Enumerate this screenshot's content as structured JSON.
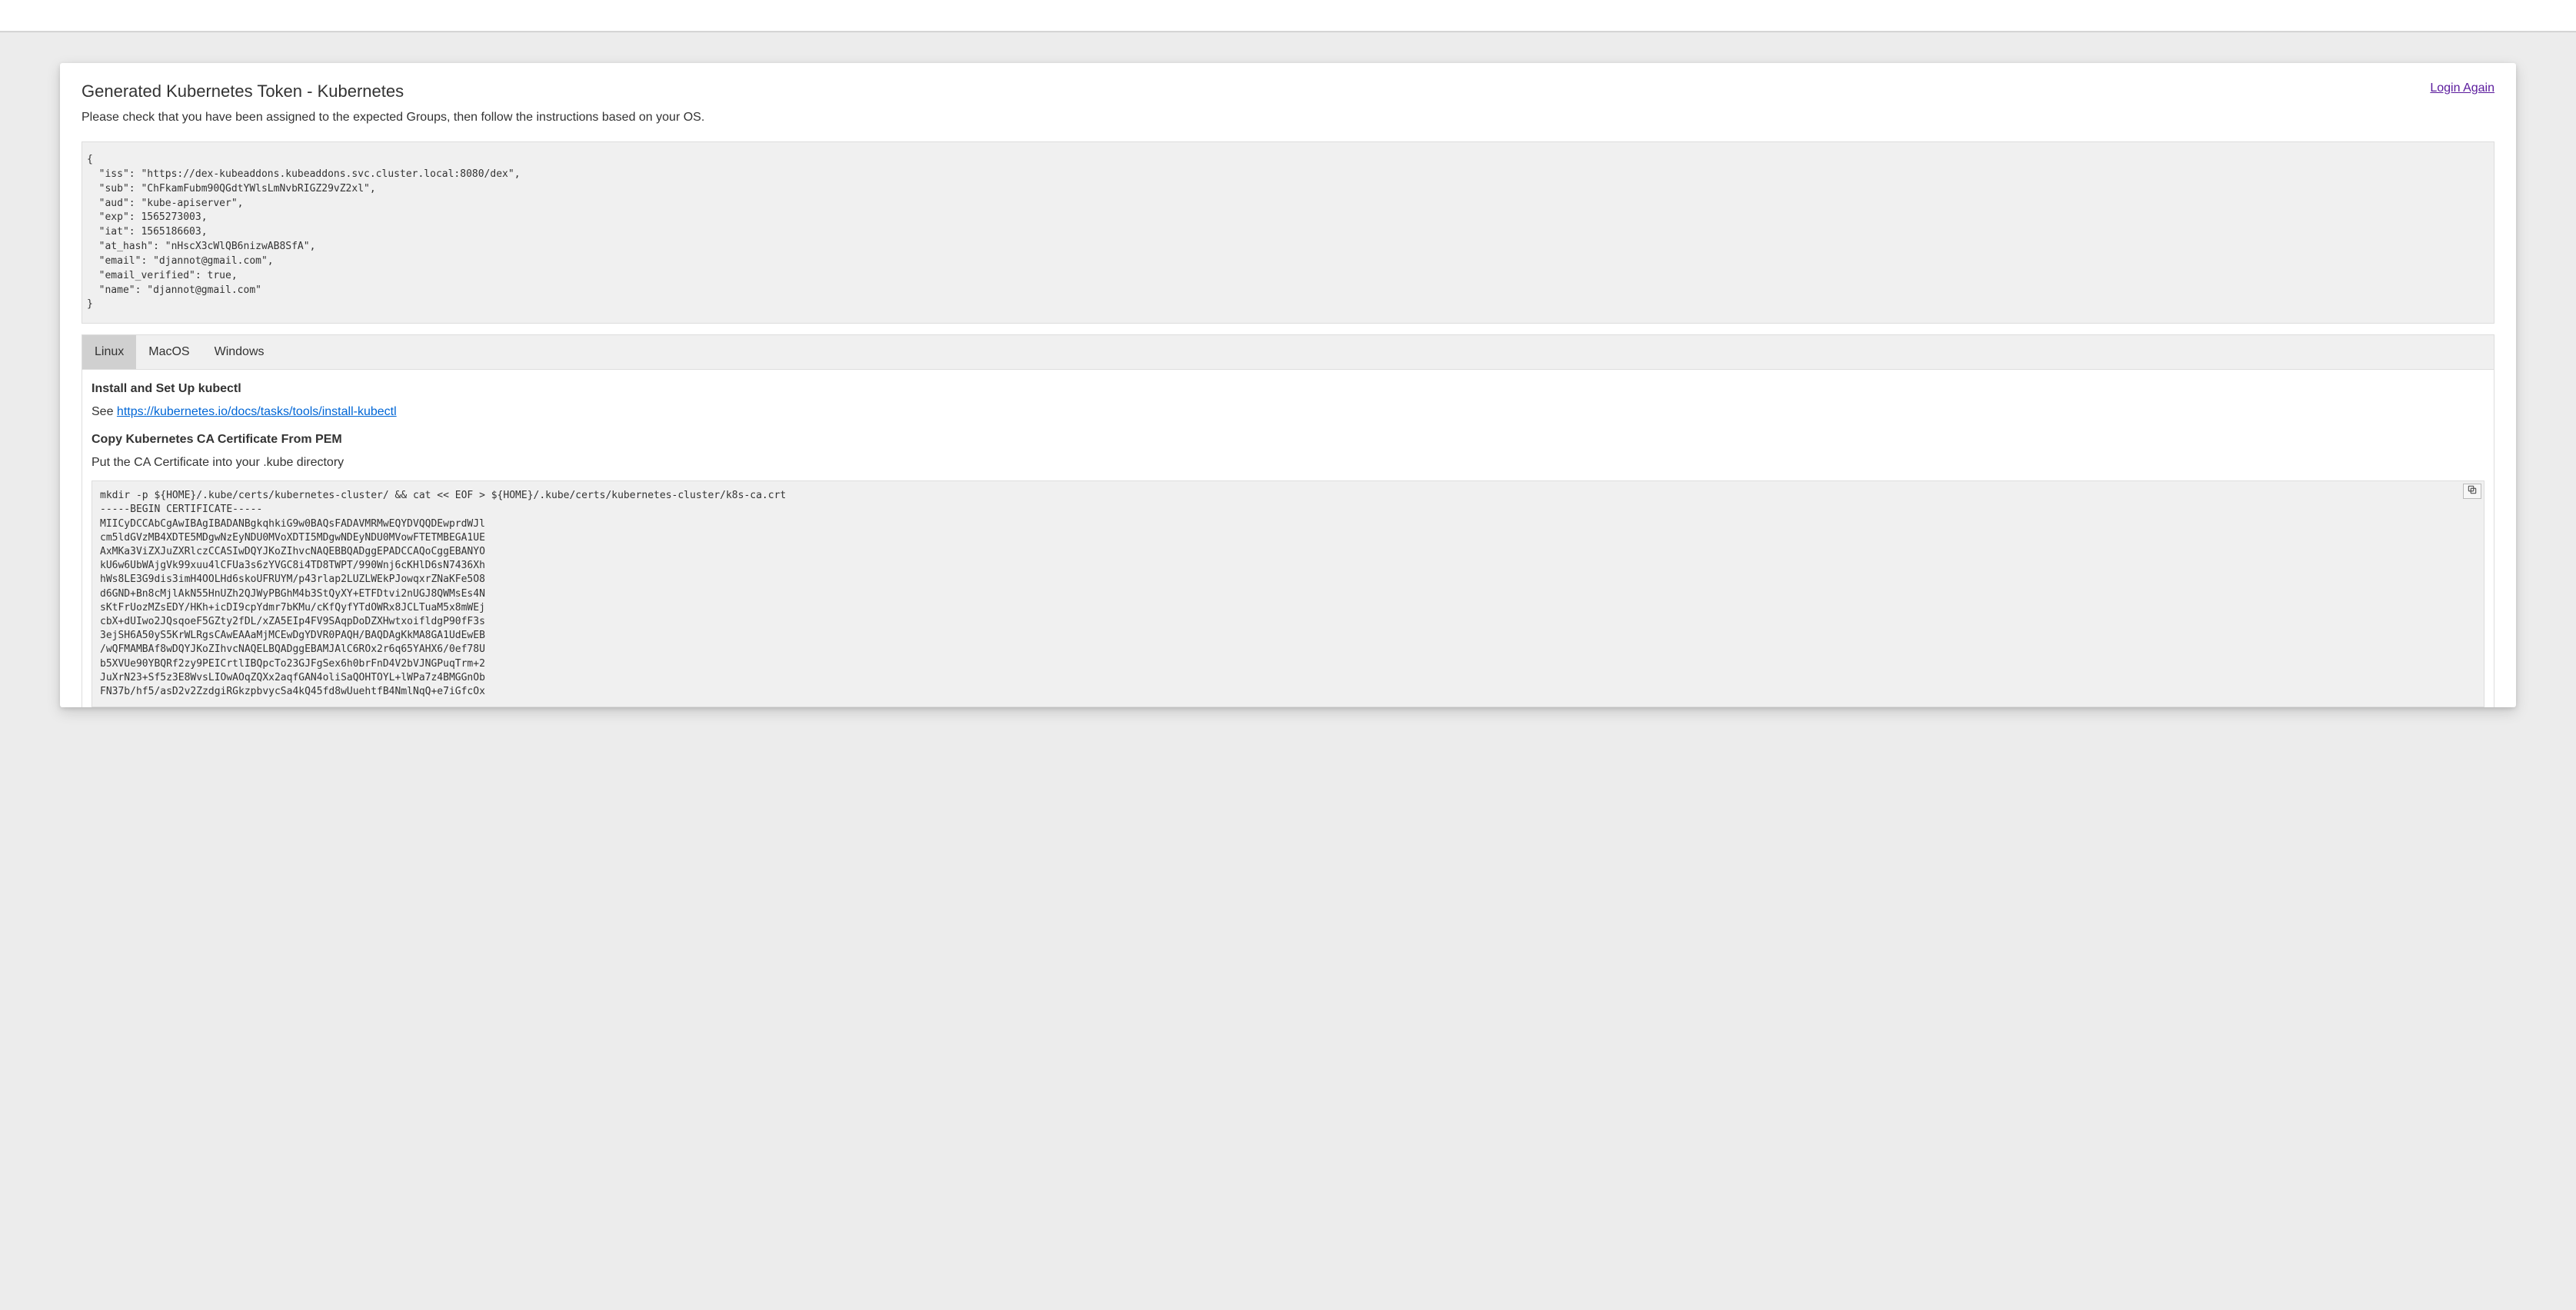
{
  "header": {
    "title": "Generated Kubernetes Token - Kubernetes",
    "login_link": "Login Again",
    "subtitle": "Please check that you have been assigned to the expected Groups, then follow the instructions based on your OS."
  },
  "token_json": "{\n  \"iss\": \"https://dex-kubeaddons.kubeaddons.svc.cluster.local:8080/dex\",\n  \"sub\": \"ChFkamFubm90QGdtYWlsLmNvbRIGZ29vZ2xl\",\n  \"aud\": \"kube-apiserver\",\n  \"exp\": 1565273003,\n  \"iat\": 1565186603,\n  \"at_hash\": \"nHscX3cWlQB6nizwAB8SfA\",\n  \"email\": \"djannot@gmail.com\",\n  \"email_verified\": true,\n  \"name\": \"djannot@gmail.com\"\n}",
  "tabs": {
    "items": [
      {
        "label": "Linux",
        "active": true
      },
      {
        "label": "MacOS",
        "active": false
      },
      {
        "label": "Windows",
        "active": false
      }
    ]
  },
  "instructions": {
    "section1_title": "Install and Set Up kubectl",
    "section1_prefix": "See ",
    "section1_link_text": "https://kubernetes.io/docs/tasks/tools/install-kubectl",
    "section1_link_href": "https://kubernetes.io/docs/tasks/tools/install-kubectl",
    "section2_title": "Copy Kubernetes CA Certificate From PEM",
    "section2_text": "Put the CA Certificate into your .kube directory",
    "code_block": "mkdir -p ${HOME}/.kube/certs/kubernetes-cluster/ && cat << EOF > ${HOME}/.kube/certs/kubernetes-cluster/k8s-ca.crt\n-----BEGIN CERTIFICATE-----\nMIICyDCCAbCgAwIBAgIBADANBgkqhkiG9w0BAQsFADAVMRMwEQYDVQQDEwprdWJl\ncm5ldGVzMB4XDTE5MDgwNzEyNDU0MVoXDTI5MDgwNDEyNDU0MVowFTETMBEGA1UE\nAxMKa3ViZXJuZXRlczCCASIwDQYJKoZIhvcNAQEBBQADggEPADCCAQoCggEBANYO\nkU6w6UbWAjgVk99xuu4lCFUa3s6zYVGC8i4TD8TWPT/990Wnj6cKHlD6sN7436Xh\nhWs8LE3G9dis3imH4OOLHd6skoUFRUYM/p43rlap2LUZLWEkPJowqxrZNaKFe5O8\nd6GND+Bn8cMjlAkN55HnUZh2QJWyPBGhM4b3StQyXY+ETFDtvi2nUGJ8QWMsEs4N\nsKtFrUozMZsEDY/HKh+icDI9cpYdmr7bKMu/cKfQyfYTdOWRx8JCLTuaM5x8mWEj\ncbX+dUIwo2JQsqoeF5GZty2fDL/xZA5EIp4FV9SAqpDoDZXHwtxoifldgP90fF3s\n3ejSH6A50yS5KrWLRgsCAwEAAaMjMCEwDgYDVR0PAQH/BAQDAgKkMA8GA1UdEwEB\n/wQFMAMBAf8wDQYJKoZIhvcNAQELBQADggEBAMJAlC6ROx2r6q65YAHX6/0ef78U\nb5XVUe90YBQRf2zy9PEICrtlIBQpcTo23GJFgSex6h0brFnD4V2bVJNGPuqTrm+2\nJuXrN23+Sf5z3E8WvsLIOwAOqZQXx2aqfGAN4oliSaQOHTOYL+lWPa7z4BMGGnOb\nFN37b/hf5/asD2v2ZzdgiRGkzpbvycSa4kQ45fd8wUuehtfB4NmlNqQ+e7iGfcOx"
  }
}
